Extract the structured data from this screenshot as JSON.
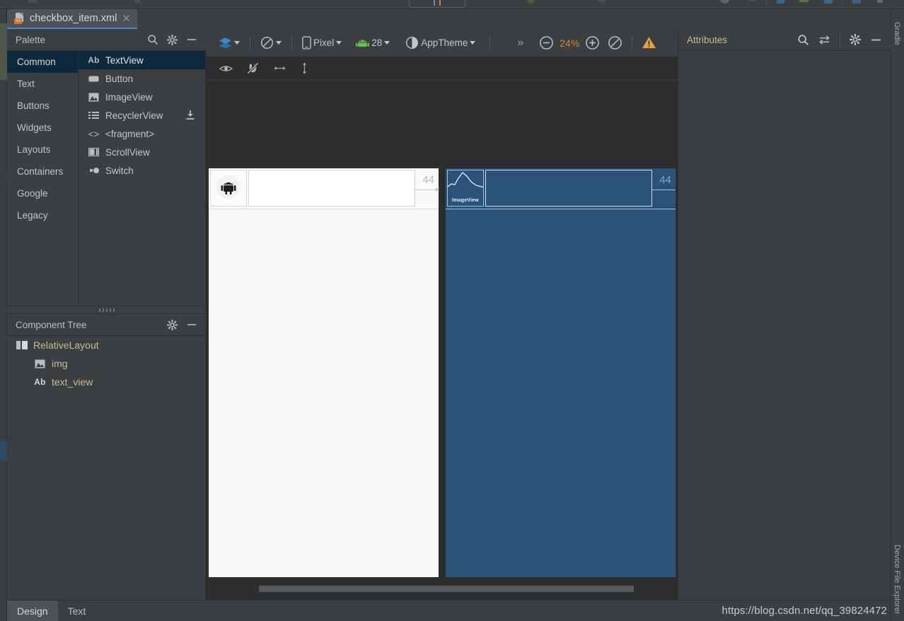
{
  "window": {
    "right_rail": [
      {
        "label": "Gradle",
        "icon": "gradle-icon"
      },
      {
        "label": "Device File Explorer",
        "icon": "device-file-explorer-icon"
      }
    ]
  },
  "editor_tab": {
    "filename": "checkbox_item.xml",
    "icon": "xml-layout-file-icon",
    "close_icon": "close-icon",
    "accent_color": "#4a88c7"
  },
  "palette": {
    "title": "Palette",
    "actions": [
      {
        "name": "search-icon",
        "glyph": "search"
      },
      {
        "name": "gear-icon",
        "glyph": "gear"
      },
      {
        "name": "minimize-icon",
        "glyph": "minus"
      }
    ],
    "categories": [
      {
        "label": "Common",
        "selected": true
      },
      {
        "label": "Text",
        "selected": false
      },
      {
        "label": "Buttons",
        "selected": false
      },
      {
        "label": "Widgets",
        "selected": false
      },
      {
        "label": "Layouts",
        "selected": false
      },
      {
        "label": "Containers",
        "selected": false
      },
      {
        "label": "Google",
        "selected": false
      },
      {
        "label": "Legacy",
        "selected": false
      }
    ],
    "items": [
      {
        "label": "TextView",
        "icon": "textview-icon",
        "glyph": "Ab",
        "selected": true,
        "download": false
      },
      {
        "label": "Button",
        "icon": "button-icon",
        "glyph": "",
        "selected": false,
        "download": false
      },
      {
        "label": "ImageView",
        "icon": "imageview-icon",
        "glyph": "",
        "selected": false,
        "download": false
      },
      {
        "label": "RecyclerView",
        "icon": "recyclerview-icon",
        "glyph": "",
        "selected": false,
        "download": true
      },
      {
        "label": "<fragment>",
        "icon": "fragment-icon",
        "glyph": "<>",
        "selected": false,
        "download": false
      },
      {
        "label": "ScrollView",
        "icon": "scrollview-icon",
        "glyph": "",
        "selected": false,
        "download": false
      },
      {
        "label": "Switch",
        "icon": "switch-icon",
        "glyph": "",
        "selected": false,
        "download": false
      }
    ]
  },
  "component_tree": {
    "title": "Component Tree",
    "actions": [
      {
        "name": "gear-icon",
        "glyph": "gear"
      },
      {
        "name": "minimize-icon",
        "glyph": "minus"
      }
    ],
    "nodes": [
      {
        "label": "RelativeLayout",
        "icon": "relativelayout-icon",
        "glyph": "",
        "level": 0
      },
      {
        "label": "img",
        "icon": "imageview-icon",
        "glyph": "",
        "level": 1
      },
      {
        "label": "text_view",
        "icon": "textview-icon",
        "glyph": "Ab",
        "level": 1
      }
    ]
  },
  "design_toolbar": {
    "design_mode": {
      "label": "",
      "icon": "layers-icon",
      "caret": true
    },
    "orientation": {
      "label": "",
      "icon": "rotate-icon",
      "caret": true
    },
    "device": {
      "label": "Pixel",
      "icon": "phone-icon",
      "caret": true
    },
    "api": {
      "label": "28",
      "icon": "android-icon",
      "caret": true
    },
    "theme": {
      "label": "AppTheme",
      "icon": "theme-contrast-icon",
      "caret": true
    },
    "overflow": {
      "label": "»",
      "icon": "overflow-chevrons-icon"
    },
    "zoom_out": {
      "icon": "zoom-out-icon"
    },
    "zoom_level": "24%",
    "zoom_in": {
      "icon": "zoom-in-icon"
    },
    "zoom_fit": {
      "icon": "zoom-fit-icon"
    },
    "warning": {
      "icon": "warning-icon",
      "color": "#e8a33d"
    }
  },
  "view_options": [
    {
      "name": "show-layout-decorations-icon",
      "glyph": "eye"
    },
    {
      "name": "turn-off-autoconnect-icon",
      "glyph": "magnet-off"
    },
    {
      "name": "horizontal-constraint-icon",
      "glyph": "arrows-h"
    },
    {
      "name": "vertical-constraint-icon",
      "glyph": "arrows-v"
    }
  ],
  "canvas": {
    "render_preview": {
      "name": "design-render-preview",
      "image_placeholder": "android-robot-icon",
      "dimension_label": "44"
    },
    "blueprint_preview": {
      "name": "blueprint-preview",
      "image_label": "ImageView",
      "dimension_label": "44",
      "color": "#2b5278"
    },
    "scrollbar": {
      "name": "canvas-horizontal-scrollbar"
    }
  },
  "attributes": {
    "title": "Attributes",
    "actions": [
      {
        "name": "search-icon",
        "glyph": "search"
      },
      {
        "name": "toggle-view-icon",
        "glyph": "swap"
      },
      {
        "name": "gear-icon",
        "glyph": "gear"
      },
      {
        "name": "minimize-icon",
        "glyph": "minus"
      }
    ]
  },
  "bottom_bar": {
    "tabs": [
      {
        "label": "Design",
        "selected": true
      },
      {
        "label": "Text",
        "selected": false
      }
    ],
    "watermark": "https://blog.csdn.net/qq_39824472"
  }
}
